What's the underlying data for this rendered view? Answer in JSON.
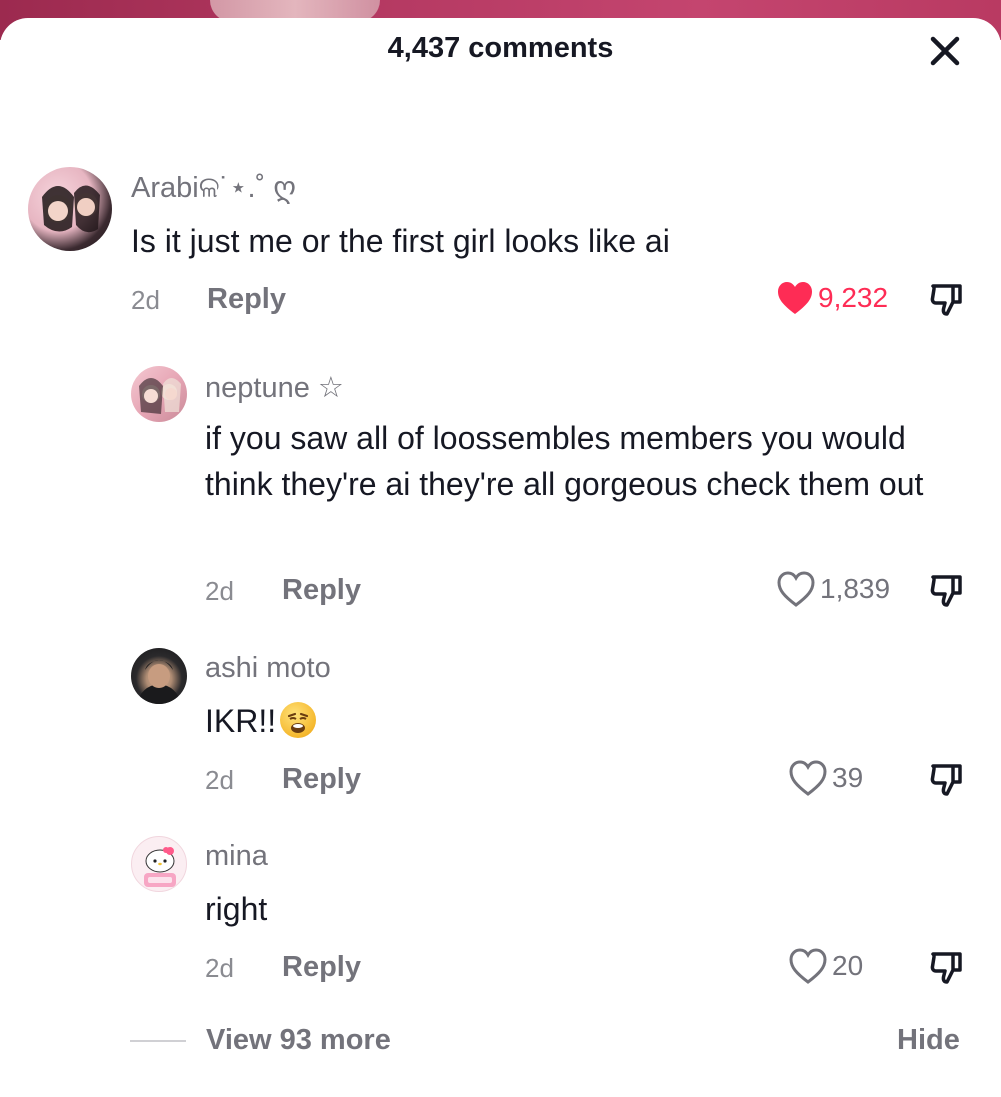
{
  "header": {
    "title": "4,437 comments",
    "close_icon": "close-icon"
  },
  "comments": [
    {
      "username": "Arabiଳ˙⋆.˚ ღ",
      "text": "Is it just me or the first girl looks like ai",
      "time": "2d",
      "reply_label": "Reply",
      "likes": "9,232",
      "liked": true
    },
    {
      "username": "neptune ☆",
      "text": "if you saw all of loossembles members you would think they're ai they're all gorgeous check them out",
      "time": "2d",
      "reply_label": "Reply",
      "likes": "1,839",
      "liked": false
    },
    {
      "username": "ashi moto",
      "text": "IKR!!",
      "emoji": "weary-face-emoji",
      "time": "2d",
      "reply_label": "Reply",
      "likes": "39",
      "liked": false
    },
    {
      "username": "mina",
      "text": "right",
      "time": "2d",
      "reply_label": "Reply",
      "likes": "20",
      "liked": false
    }
  ],
  "footer": {
    "view_more_label": "View 93 more",
    "hide_label": "Hide"
  },
  "colors": {
    "liked_heart": "#fe2c55",
    "text_primary": "#161823",
    "text_secondary": "#73737b"
  }
}
